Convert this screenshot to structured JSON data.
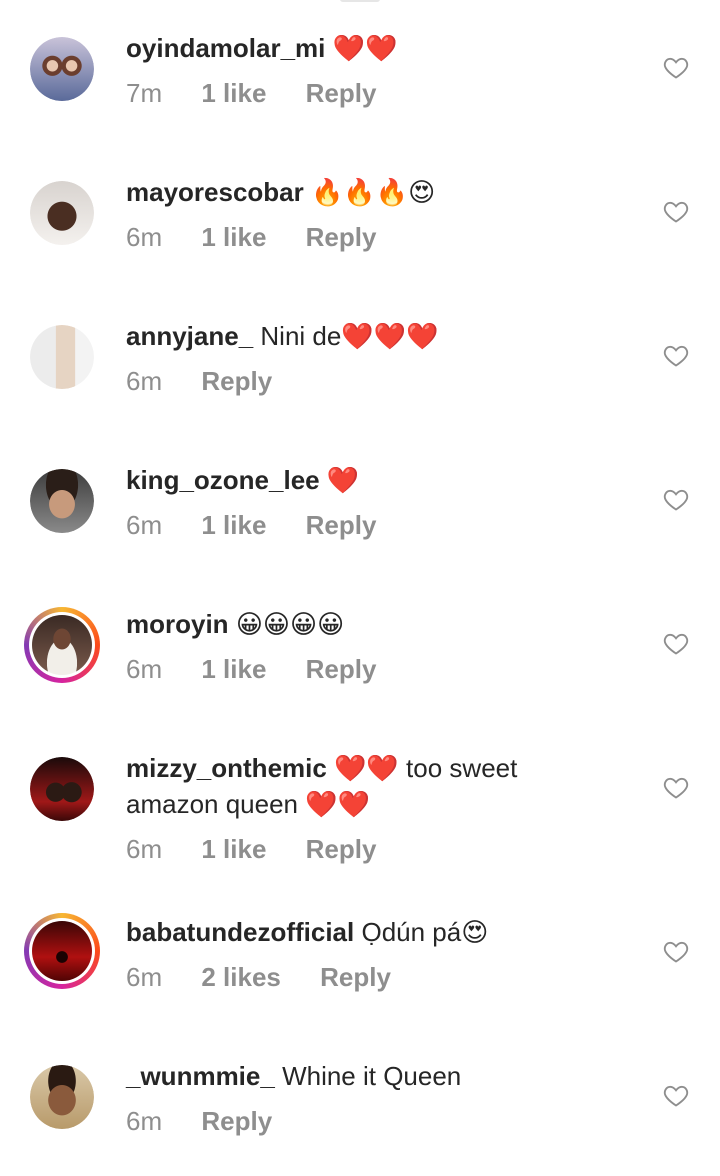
{
  "comments": [
    {
      "username": "oyindamolar_mi",
      "text": "",
      "emoji": "❤️❤️",
      "time": "7m",
      "likes": "1 like",
      "reply": "Reply"
    },
    {
      "username": "mayorescobar",
      "text": "",
      "emoji": "🔥🔥🔥😍",
      "time": "6m",
      "likes": "1 like",
      "reply": "Reply"
    },
    {
      "username": "annyjane_",
      "text": "Nini de",
      "emoji": "❤️❤️❤️",
      "time": "6m",
      "likes": "",
      "reply": "Reply"
    },
    {
      "username": "king_ozone_lee",
      "text": "",
      "emoji": "❤️",
      "time": "6m",
      "likes": "1 like",
      "reply": "Reply"
    },
    {
      "username": "moroyin",
      "text": "",
      "emoji": "😀😀😀😀",
      "time": "6m",
      "likes": "1 like",
      "reply": "Reply"
    },
    {
      "username": "mizzy_onthemic",
      "text": "too sweet amazon queen",
      "emoji": "❤️❤️",
      "emoji2": "❤️❤️",
      "time": "6m",
      "likes": "1 like",
      "reply": "Reply"
    },
    {
      "username": "babatundezofficial",
      "text": "Ọdún pá",
      "emoji": "😍",
      "time": "6m",
      "likes": "2 likes",
      "reply": "Reply"
    },
    {
      "username": "_wunmmie_",
      "text": "Whine it Queen",
      "emoji": "",
      "time": "6m",
      "likes": "",
      "reply": "Reply"
    }
  ],
  "colors": {
    "username": "#262626",
    "meta": "#8e8e8e",
    "heart_outline": "#8e8e8e"
  },
  "icons": {
    "like": "heart-outline-icon"
  }
}
